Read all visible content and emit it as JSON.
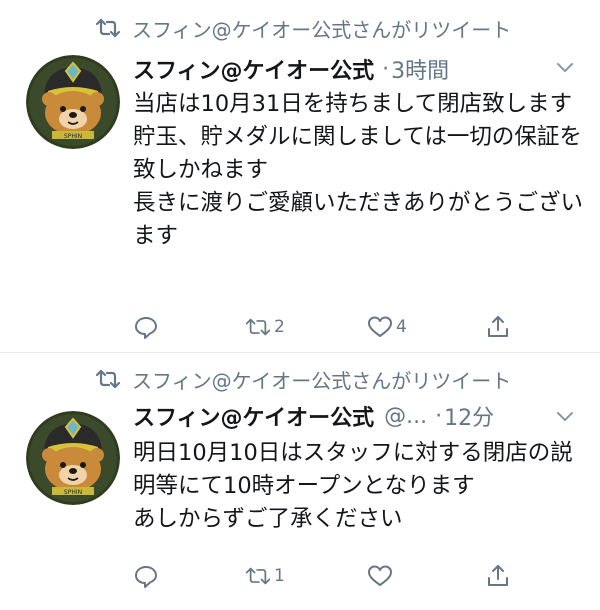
{
  "tweets": [
    {
      "retweet_text": "スフィン@ケイオー公式さんがリツイート",
      "display_name": "スフィン@ケイオー公式",
      "handle": "",
      "separator": "·",
      "time": "3時間",
      "body": "当店は10月31日を持ちまして閉店致します\n貯玉、貯メダルに関しましては一切の保証を致しかねます\n長きに渡りご愛顧いただきありがとうございます",
      "actions": {
        "reply_count": "",
        "retweet_count": "2",
        "like_count": "4"
      },
      "icons": [
        "retweet-icon",
        "avatar",
        "chevron-down-icon",
        "reply-icon",
        "retweet-icon",
        "like-icon",
        "share-icon"
      ]
    },
    {
      "retweet_text": "スフィン@ケイオー公式さんがリツイート",
      "display_name": "スフィン@ケイオー公式",
      "handle": "@...",
      "separator": "·",
      "time": "12分",
      "body": "明日10月10日はスタッフに対する閉店の説明等にて10時オープンとなります\nあしからずご了承ください",
      "actions": {
        "reply_count": "",
        "retweet_count": "1",
        "like_count": ""
      },
      "icons": [
        "retweet-icon",
        "avatar",
        "chevron-down-icon",
        "reply-icon",
        "retweet-icon",
        "like-icon",
        "share-icon"
      ]
    }
  ],
  "colors": {
    "text": "#14171a",
    "secondary": "#657786",
    "divider": "#e6ecf0"
  }
}
